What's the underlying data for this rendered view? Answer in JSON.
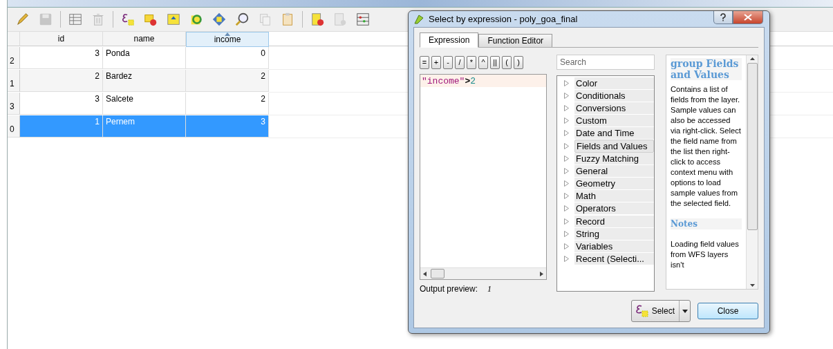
{
  "toolbar": [
    {
      "disabled": false
    },
    {
      "disabled": true
    },
    {
      "disabled": false
    },
    {
      "disabled": true
    },
    {
      "disabled": false
    },
    {
      "disabled": false
    },
    {
      "disabled": false
    },
    {
      "disabled": false
    },
    {
      "disabled": false
    },
    {
      "disabled": false
    },
    {
      "disabled": true
    },
    {
      "disabled": false
    },
    {
      "disabled": false
    },
    {
      "disabled": true
    },
    {
      "disabled": false
    }
  ],
  "table": {
    "columns": [
      {
        "label": "id",
        "sorted": false
      },
      {
        "label": "name",
        "sorted": false
      },
      {
        "label": "income",
        "sorted": true
      }
    ],
    "rows": [
      {
        "header": "2",
        "cells": [
          "3",
          "Ponda",
          "0"
        ],
        "selected": false
      },
      {
        "header": "1",
        "cells": [
          "2",
          "Bardez",
          "2"
        ],
        "selected": false
      },
      {
        "header": "3",
        "cells": [
          "3",
          "Salcete",
          "2"
        ],
        "selected": false
      },
      {
        "header": "0",
        "cells": [
          "1",
          "Pernem",
          "3"
        ],
        "selected": true
      }
    ]
  },
  "dialog": {
    "title": "Select by expression - poly_goa_final",
    "tabs": [
      {
        "label": "Expression",
        "selected": true
      },
      {
        "label": "Function Editor",
        "selected": false
      }
    ],
    "operators": [
      "=",
      "+",
      "-",
      "/",
      "*",
      "^",
      "||",
      "(",
      ")"
    ],
    "expression": {
      "field": "\"income\"",
      "operator": ">",
      "value": "2"
    },
    "search": {
      "placeholder": "Search"
    },
    "groups": [
      {
        "label": "Color",
        "selected": false
      },
      {
        "label": "Conditionals",
        "selected": false
      },
      {
        "label": "Conversions",
        "selected": false
      },
      {
        "label": "Custom",
        "selected": false
      },
      {
        "label": "Date and Time",
        "selected": false
      },
      {
        "label": "Fields and Values",
        "selected": true
      },
      {
        "label": "Fuzzy Matching",
        "selected": false
      },
      {
        "label": "General",
        "selected": false
      },
      {
        "label": "Geometry",
        "selected": false
      },
      {
        "label": "Math",
        "selected": false
      },
      {
        "label": "Operators",
        "selected": false
      },
      {
        "label": "Record",
        "selected": false
      },
      {
        "label": "String",
        "selected": false
      },
      {
        "label": "Variables",
        "selected": false
      },
      {
        "label": "Recent (Selecti...",
        "selected": false
      }
    ],
    "help": {
      "heading": "group Fields and Values",
      "body": "Contains a list of fields from the layer. Sample values can also be accessed via right-click. Select the field name from the list then right-click to access context menu with options to load sample values from the selected field.",
      "notes_heading": "Notes",
      "notes": "Loading field values from WFS layers isn't"
    },
    "output_preview": {
      "label": "Output preview:",
      "value": "1"
    },
    "buttons": {
      "select": "Select",
      "close": "Close"
    }
  }
}
